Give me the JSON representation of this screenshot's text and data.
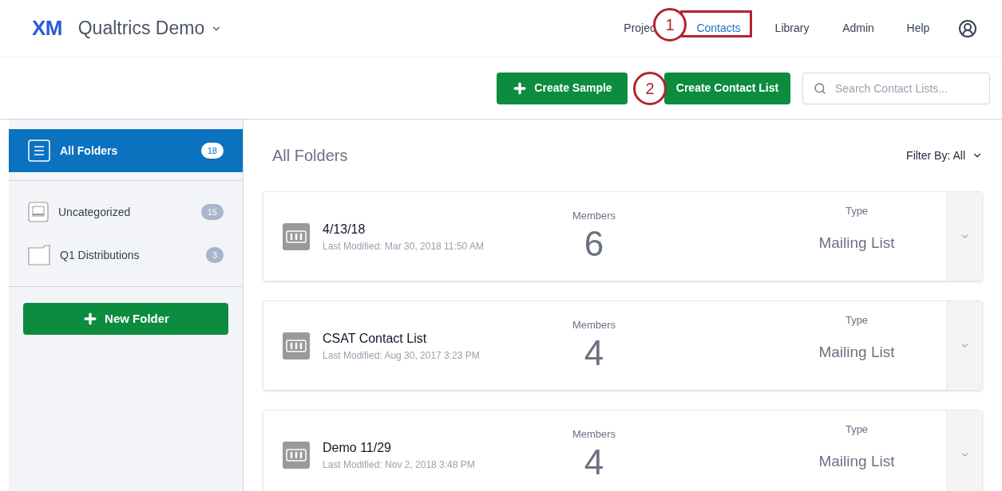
{
  "header": {
    "logo": "XM",
    "brand": "Qualtrics Demo",
    "nav": [
      {
        "label": "Projec",
        "selected": false
      },
      {
        "label": "Contacts",
        "selected": true
      },
      {
        "label": "Library",
        "selected": false
      },
      {
        "label": "Admin",
        "selected": false
      },
      {
        "label": "Help",
        "selected": false
      }
    ]
  },
  "toolbar": {
    "buttons": [
      "Create Sample",
      "Create Contact List"
    ],
    "search": {
      "placeholder": "Search Contact Lists..."
    }
  },
  "sidebar": {
    "items": [
      {
        "label": "All Folders",
        "count": "18",
        "selected": true,
        "kind": "all"
      },
      {
        "label": "Uncategorized",
        "count": "15",
        "selected": false,
        "kind": "uncategorized"
      },
      {
        "label": "Q1 Distributions",
        "count": "3",
        "selected": false,
        "kind": "folder"
      }
    ],
    "new_button": "New Folder"
  },
  "main": {
    "title": "All Folders",
    "filter": "Filter By: All",
    "lists": [
      {
        "name": "4/13/18",
        "modified": "Last Modified: Mar 30, 2018 11:50 AM",
        "members_label": "Members",
        "members": "6",
        "type_label": "Type",
        "type": "Mailing List"
      },
      {
        "name": "CSAT Contact List",
        "modified": "Last Modified: Aug 30, 2017 3:23 PM",
        "members_label": "Members",
        "members": "4",
        "type_label": "Type",
        "type": "Mailing List"
      },
      {
        "name": "Demo 11/29",
        "modified": "Last Modified: Nov 2, 2018 3:48 PM",
        "members_label": "Members",
        "members": "4",
        "type_label": "Type",
        "type": "Mailing List"
      }
    ]
  },
  "callouts": [
    "1",
    "2"
  ]
}
